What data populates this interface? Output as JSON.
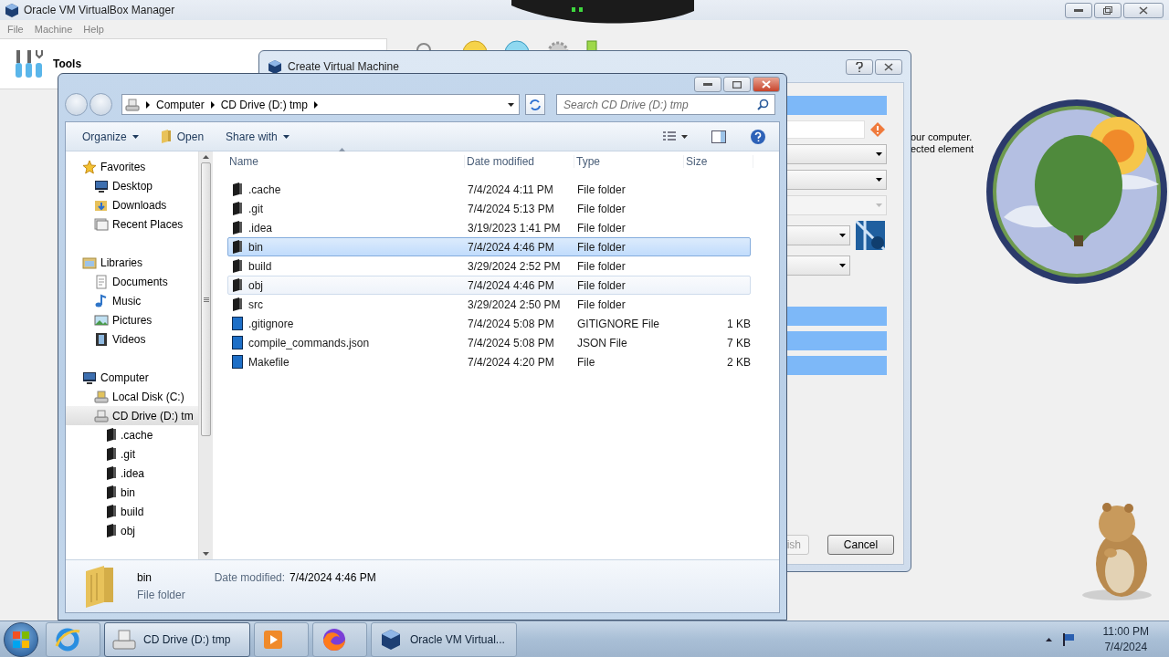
{
  "manager": {
    "title": "Oracle VM VirtualBox Manager",
    "menu": [
      "File",
      "Machine",
      "Help"
    ],
    "tools_label": "Tools",
    "hint_lines": [
      "our computer.",
      "ected element"
    ]
  },
  "create_dialog": {
    "title": "Create Virtual Machine",
    "fields": [
      {
        "kind": "bar"
      },
      {
        "kind": "text",
        "warning": true
      },
      {
        "kind": "combo",
        "disabled": false
      },
      {
        "kind": "combo",
        "disabled": false
      },
      {
        "kind": "combo",
        "disabled": true
      },
      {
        "kind": "combo_logo",
        "disabled": false
      },
      {
        "kind": "combo_short",
        "disabled": false
      },
      {
        "kind": "gap"
      },
      {
        "kind": "bar"
      },
      {
        "kind": "bar"
      },
      {
        "kind": "bar"
      }
    ],
    "buttons": [
      {
        "label": "ish",
        "disabled": true
      },
      {
        "label": "Cancel",
        "disabled": false
      }
    ]
  },
  "file_dialog": {
    "breadcrumb": [
      "Computer",
      "CD Drive (D:) tmp"
    ],
    "search": {
      "placeholder": "Search CD Drive (D:) tmp"
    },
    "toolbar": [
      {
        "label": "Organize",
        "kind": "menu"
      },
      {
        "label": "Open",
        "kind": "open"
      },
      {
        "label": "Share with",
        "kind": "menu"
      }
    ],
    "nav": [
      {
        "label": "Favorites",
        "kind": "star",
        "selected": false,
        "children": [
          {
            "label": "Desktop",
            "kind": "desktop",
            "selected": false
          },
          {
            "label": "Downloads",
            "kind": "downloads",
            "selected": false
          },
          {
            "label": "Recent Places",
            "kind": "recent",
            "selected": false
          }
        ]
      },
      {
        "label": "Libraries",
        "kind": "library",
        "selected": false,
        "children": [
          {
            "label": "Documents",
            "kind": "documents",
            "selected": false
          },
          {
            "label": "Music",
            "kind": "music",
            "selected": false
          },
          {
            "label": "Pictures",
            "kind": "pictures",
            "selected": false
          },
          {
            "label": "Videos",
            "kind": "videos",
            "selected": false
          }
        ]
      },
      {
        "label": "Computer",
        "kind": "computer",
        "selected": false,
        "children": [
          {
            "label": "Local Disk (C:)",
            "kind": "disk",
            "selected": false
          },
          {
            "label": "CD Drive (D:) tm",
            "kind": "cd",
            "selected": true,
            "children": [
              {
                "label": ".cache",
                "kind": "folder",
                "selected": false
              },
              {
                "label": ".git",
                "kind": "folder",
                "selected": false
              },
              {
                "label": ".idea",
                "kind": "folder",
                "selected": false
              },
              {
                "label": "bin",
                "kind": "folder",
                "selected": false
              },
              {
                "label": "build",
                "kind": "folder",
                "selected": false
              },
              {
                "label": "obj",
                "kind": "folder",
                "selected": false
              }
            ]
          }
        ]
      }
    ],
    "columns": [
      "Name",
      "Date modified",
      "Type",
      "Size"
    ],
    "rows": [
      {
        "name": ".cache",
        "date": "7/4/2024 4:11 PM",
        "type": "File folder",
        "kind": "folder",
        "selected": false,
        "hovered": false
      },
      {
        "name": ".git",
        "date": "7/4/2024 5:13 PM",
        "type": "File folder",
        "kind": "folder",
        "selected": false,
        "hovered": false
      },
      {
        "name": ".idea",
        "date": "3/19/2023 1:41 PM",
        "type": "File folder",
        "kind": "folder",
        "selected": false,
        "hovered": false
      },
      {
        "name": "bin",
        "date": "7/4/2024 4:46 PM",
        "type": "File folder",
        "kind": "folder",
        "selected": true,
        "hovered": false
      },
      {
        "name": "build",
        "date": "3/29/2024 2:52 PM",
        "type": "File folder",
        "kind": "folder",
        "selected": false,
        "hovered": false
      },
      {
        "name": "obj",
        "date": "7/4/2024 4:46 PM",
        "type": "File folder",
        "kind": "folder",
        "selected": false,
        "hovered": true
      },
      {
        "name": "src",
        "date": "3/29/2024 2:50 PM",
        "type": "File folder",
        "kind": "folder",
        "selected": false,
        "hovered": false
      },
      {
        "name": ".gitignore",
        "date": "7/4/2024 5:08 PM",
        "type": "GITIGNORE File",
        "size": "1 KB",
        "kind": "file",
        "selected": false,
        "hovered": false
      },
      {
        "name": "compile_commands.json",
        "date": "7/4/2024 5:08 PM",
        "type": "JSON File",
        "size": "7 KB",
        "kind": "file",
        "selected": false,
        "hovered": false
      },
      {
        "name": "Makefile",
        "date": "7/4/2024 4:20 PM",
        "type": "File",
        "size": "2 KB",
        "kind": "file",
        "selected": false,
        "hovered": false
      }
    ],
    "details": {
      "name": "bin",
      "type": "File folder",
      "date_label": "Date modified:",
      "date": "7/4/2024 4:46 PM"
    }
  },
  "taskbar": {
    "items": [
      {
        "kind": "ie",
        "active": false
      },
      {
        "kind": "explorer",
        "label": "CD Drive (D:) tmp",
        "active": true
      },
      {
        "kind": "media",
        "active": false
      },
      {
        "kind": "firefox",
        "active": false
      },
      {
        "kind": "vbox",
        "label": "Oracle VM Virtual...",
        "active": false
      }
    ],
    "clock": {
      "time": "11:00 PM",
      "date": "7/4/2024"
    }
  }
}
